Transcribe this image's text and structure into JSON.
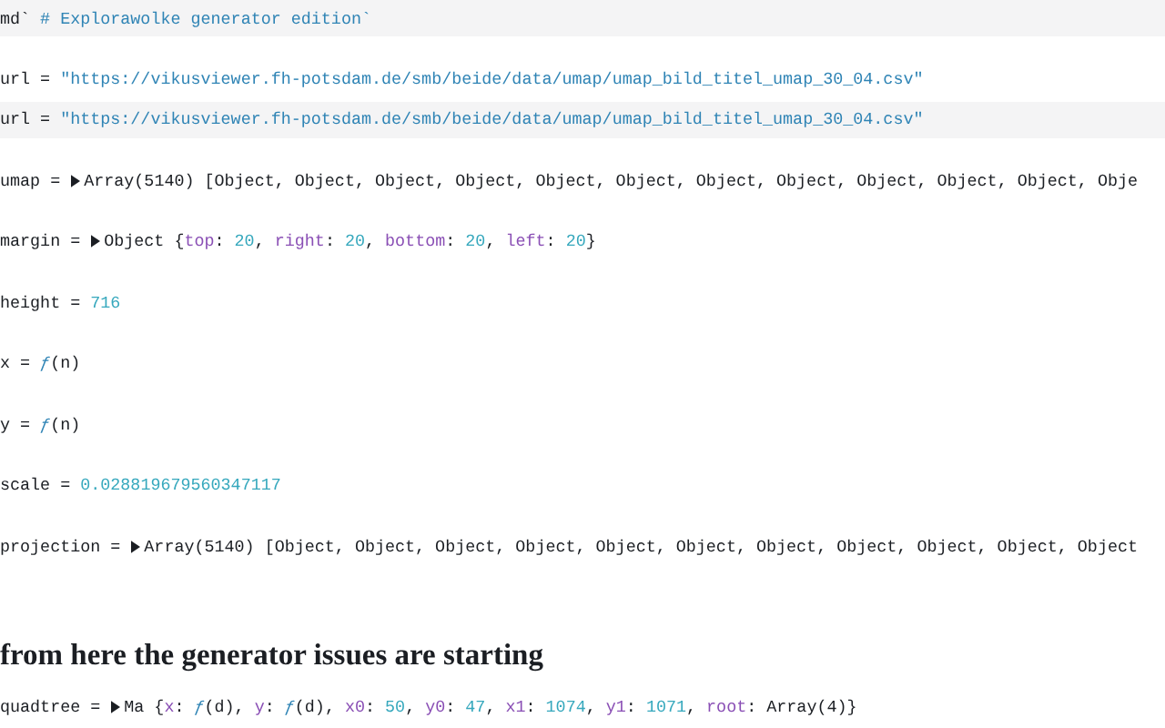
{
  "cells": [
    {
      "kind": "source",
      "label": "md`",
      "value": [
        {
          "kind": "string",
          "text": "# Explorawolke generator edition`"
        }
      ]
    },
    {
      "kind": "output",
      "label": "url =",
      "value": [
        {
          "kind": "string",
          "text": "\"https://vikusviewer.fh-potsdam.de/smb/beide/data/umap/umap_bild_titel_umap_30_04.csv\""
        }
      ]
    },
    {
      "kind": "source",
      "label": "url =",
      "value": [
        {
          "kind": "string",
          "text": "\"https://vikusviewer.fh-potsdam.de/smb/beide/data/umap/umap_bild_titel_umap_30_04.csv\""
        }
      ]
    },
    {
      "kind": "output",
      "label": "umap =",
      "expander": {
        "expanded": false
      },
      "value": [
        {
          "kind": "text",
          "text": "Array(5140) [Object, Object, Object, Object, Object, Object, Object, Object, Object, Object, Object, Obje"
        }
      ]
    },
    {
      "kind": "output",
      "label": "margin =",
      "expander": {
        "expanded": false
      },
      "value": [
        {
          "kind": "text",
          "text": "Object {"
        },
        {
          "kind": "key",
          "text": "top"
        },
        {
          "kind": "text",
          "text": ": "
        },
        {
          "kind": "number",
          "text": "20"
        },
        {
          "kind": "text",
          "text": ", "
        },
        {
          "kind": "key",
          "text": "right"
        },
        {
          "kind": "text",
          "text": ": "
        },
        {
          "kind": "number",
          "text": "20"
        },
        {
          "kind": "text",
          "text": ", "
        },
        {
          "kind": "key",
          "text": "bottom"
        },
        {
          "kind": "text",
          "text": ": "
        },
        {
          "kind": "number",
          "text": "20"
        },
        {
          "kind": "text",
          "text": ", "
        },
        {
          "kind": "key",
          "text": "left"
        },
        {
          "kind": "text",
          "text": ": "
        },
        {
          "kind": "number",
          "text": "20"
        },
        {
          "kind": "text",
          "text": "}"
        }
      ]
    },
    {
      "kind": "output",
      "label": "height =",
      "value": [
        {
          "kind": "number",
          "text": "716"
        }
      ]
    },
    {
      "kind": "output",
      "label": "x =",
      "value": [
        {
          "kind": "fn",
          "text": "ƒ"
        },
        {
          "kind": "text",
          "text": "(n)"
        }
      ]
    },
    {
      "kind": "output",
      "label": "y =",
      "value": [
        {
          "kind": "fn",
          "text": "ƒ"
        },
        {
          "kind": "text",
          "text": "(n)"
        }
      ]
    },
    {
      "kind": "output",
      "label": "scale =",
      "value": [
        {
          "kind": "number",
          "text": "0.028819679560347117"
        }
      ]
    },
    {
      "kind": "output",
      "label": "projection =",
      "expander": {
        "expanded": false
      },
      "value": [
        {
          "kind": "text",
          "text": "Array(5140) [Object, Object, Object, Object, Object, Object, Object, Object, Object, Object, Object"
        }
      ]
    },
    {
      "kind": "heading",
      "label": "from here the generator issues are starting"
    },
    {
      "kind": "output",
      "label": "quadtree =",
      "expander": {
        "expanded": false
      },
      "value": [
        {
          "kind": "text",
          "text": "Ma {"
        },
        {
          "kind": "key",
          "text": "x"
        },
        {
          "kind": "text",
          "text": ": "
        },
        {
          "kind": "fn",
          "text": "ƒ"
        },
        {
          "kind": "text",
          "text": "(d), "
        },
        {
          "kind": "key",
          "text": "y"
        },
        {
          "kind": "text",
          "text": ": "
        },
        {
          "kind": "fn",
          "text": "ƒ"
        },
        {
          "kind": "text",
          "text": "(d), "
        },
        {
          "kind": "key",
          "text": "x0"
        },
        {
          "kind": "text",
          "text": ": "
        },
        {
          "kind": "number",
          "text": "50"
        },
        {
          "kind": "text",
          "text": ", "
        },
        {
          "kind": "key",
          "text": "y0"
        },
        {
          "kind": "text",
          "text": ": "
        },
        {
          "kind": "number",
          "text": "47"
        },
        {
          "kind": "text",
          "text": ", "
        },
        {
          "kind": "key",
          "text": "x1"
        },
        {
          "kind": "text",
          "text": ": "
        },
        {
          "kind": "number",
          "text": "1074"
        },
        {
          "kind": "text",
          "text": ", "
        },
        {
          "kind": "key",
          "text": "y1"
        },
        {
          "kind": "text",
          "text": ": "
        },
        {
          "kind": "number",
          "text": "1071"
        },
        {
          "kind": "text",
          "text": ", "
        },
        {
          "kind": "key",
          "text": "root"
        },
        {
          "kind": "text",
          "text": ": Array(4)}"
        }
      ]
    }
  ]
}
